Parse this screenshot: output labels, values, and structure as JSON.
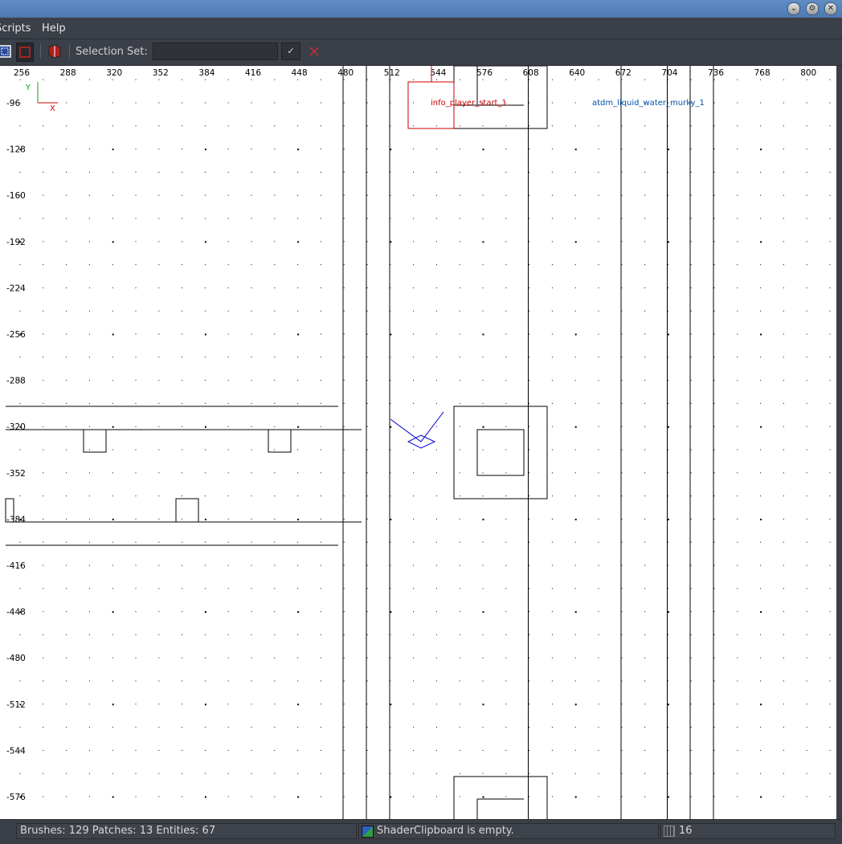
{
  "menubar": {
    "items": [
      "Scripts",
      "Help"
    ]
  },
  "window_buttons": [
    "minimize-icon",
    "maximize-icon",
    "close-icon"
  ],
  "toolbar": {
    "selection_set_label": "Selection Set:",
    "selection_set_value": "",
    "icons": [
      "select-entity-icon",
      "select-brush-icon",
      "model-icon",
      "clear-selection-icon"
    ]
  },
  "viewport": {
    "x_ticks": [
      "256",
      "288",
      "320",
      "352",
      "384",
      "416",
      "448",
      "480",
      "512",
      "544",
      "576",
      "608",
      "640",
      "672",
      "704",
      "736",
      "768",
      "800"
    ],
    "y_ticks": [
      "-96",
      "-128",
      "-160",
      "-192",
      "-224",
      "-256",
      "-288",
      "-320",
      "-352",
      "-384",
      "-416",
      "-448",
      "-480",
      "-512",
      "-544",
      "-576"
    ],
    "axis_labels": {
      "x": "X",
      "y": "Y"
    },
    "entities": [
      {
        "label": "info_player_start_1",
        "color": "#cc0000"
      },
      {
        "label": "atdm_liquid_water_murky_1",
        "color": "#0055aa"
      }
    ],
    "grid_color": "#000000",
    "brush_color": "#000000",
    "camera_color": "#0000cc"
  },
  "status": {
    "counts": "Brushes: 129 Patches: 13 Entities: 67",
    "shader_clipboard": "ShaderClipboard is empty.",
    "grid_size": "16"
  }
}
